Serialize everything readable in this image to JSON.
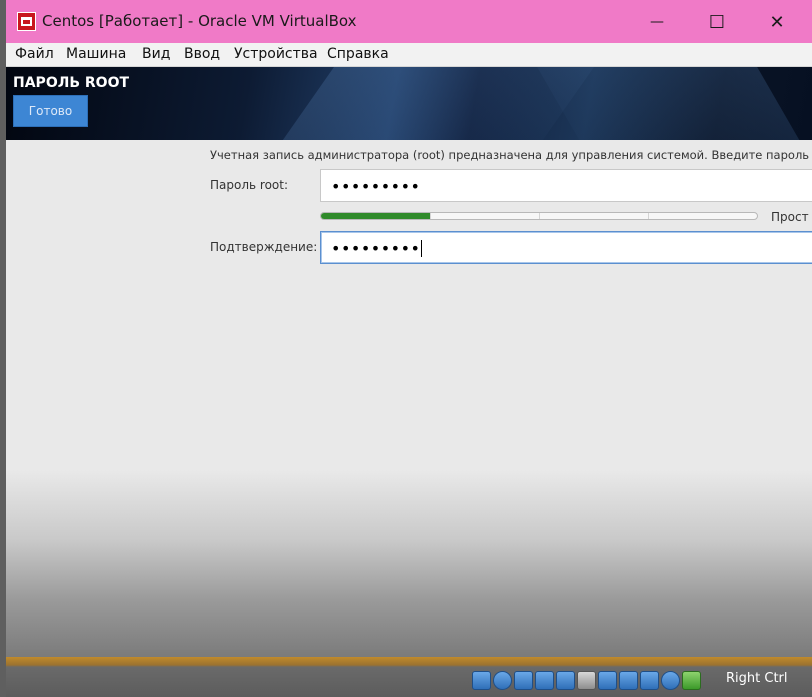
{
  "window": {
    "title": "Centos [Работает] - Oracle VM VirtualBox",
    "controls": {
      "minimize": "—",
      "maximize": "☐",
      "close": "✕"
    },
    "menu": [
      "Файл",
      "Машина",
      "Вид",
      "Ввод",
      "Устройства",
      "Справка"
    ]
  },
  "header": {
    "title": "ПАРОЛЬ ROOT",
    "done_button": "Готово"
  },
  "form": {
    "description": "Учетная запись администратора (root) предназначена для управления системой. Введите пароль п",
    "password_label": "Пароль root:",
    "password_value": "•••••••••",
    "strength_fraction": 0.25,
    "strength_label": "Прост",
    "confirm_label": "Подтверждение:",
    "confirm_value": "•••••••••"
  },
  "statusbar": {
    "tray_icons": [
      "hard-disk-icon",
      "optical-drive-icon",
      "audio-icon",
      "network-icon",
      "usb-icon",
      "shared-folders-icon",
      "display-icon",
      "recording-icon",
      "cpu-icon",
      "mouse-integration-icon",
      "keyboard-icon"
    ],
    "host_key": "Right Ctrl"
  },
  "colors": {
    "titlebar": "#f07ac7",
    "done_button": "#3d86d4",
    "strength_fill": "#2f8a2a",
    "focus_border": "#5b8fcf"
  }
}
